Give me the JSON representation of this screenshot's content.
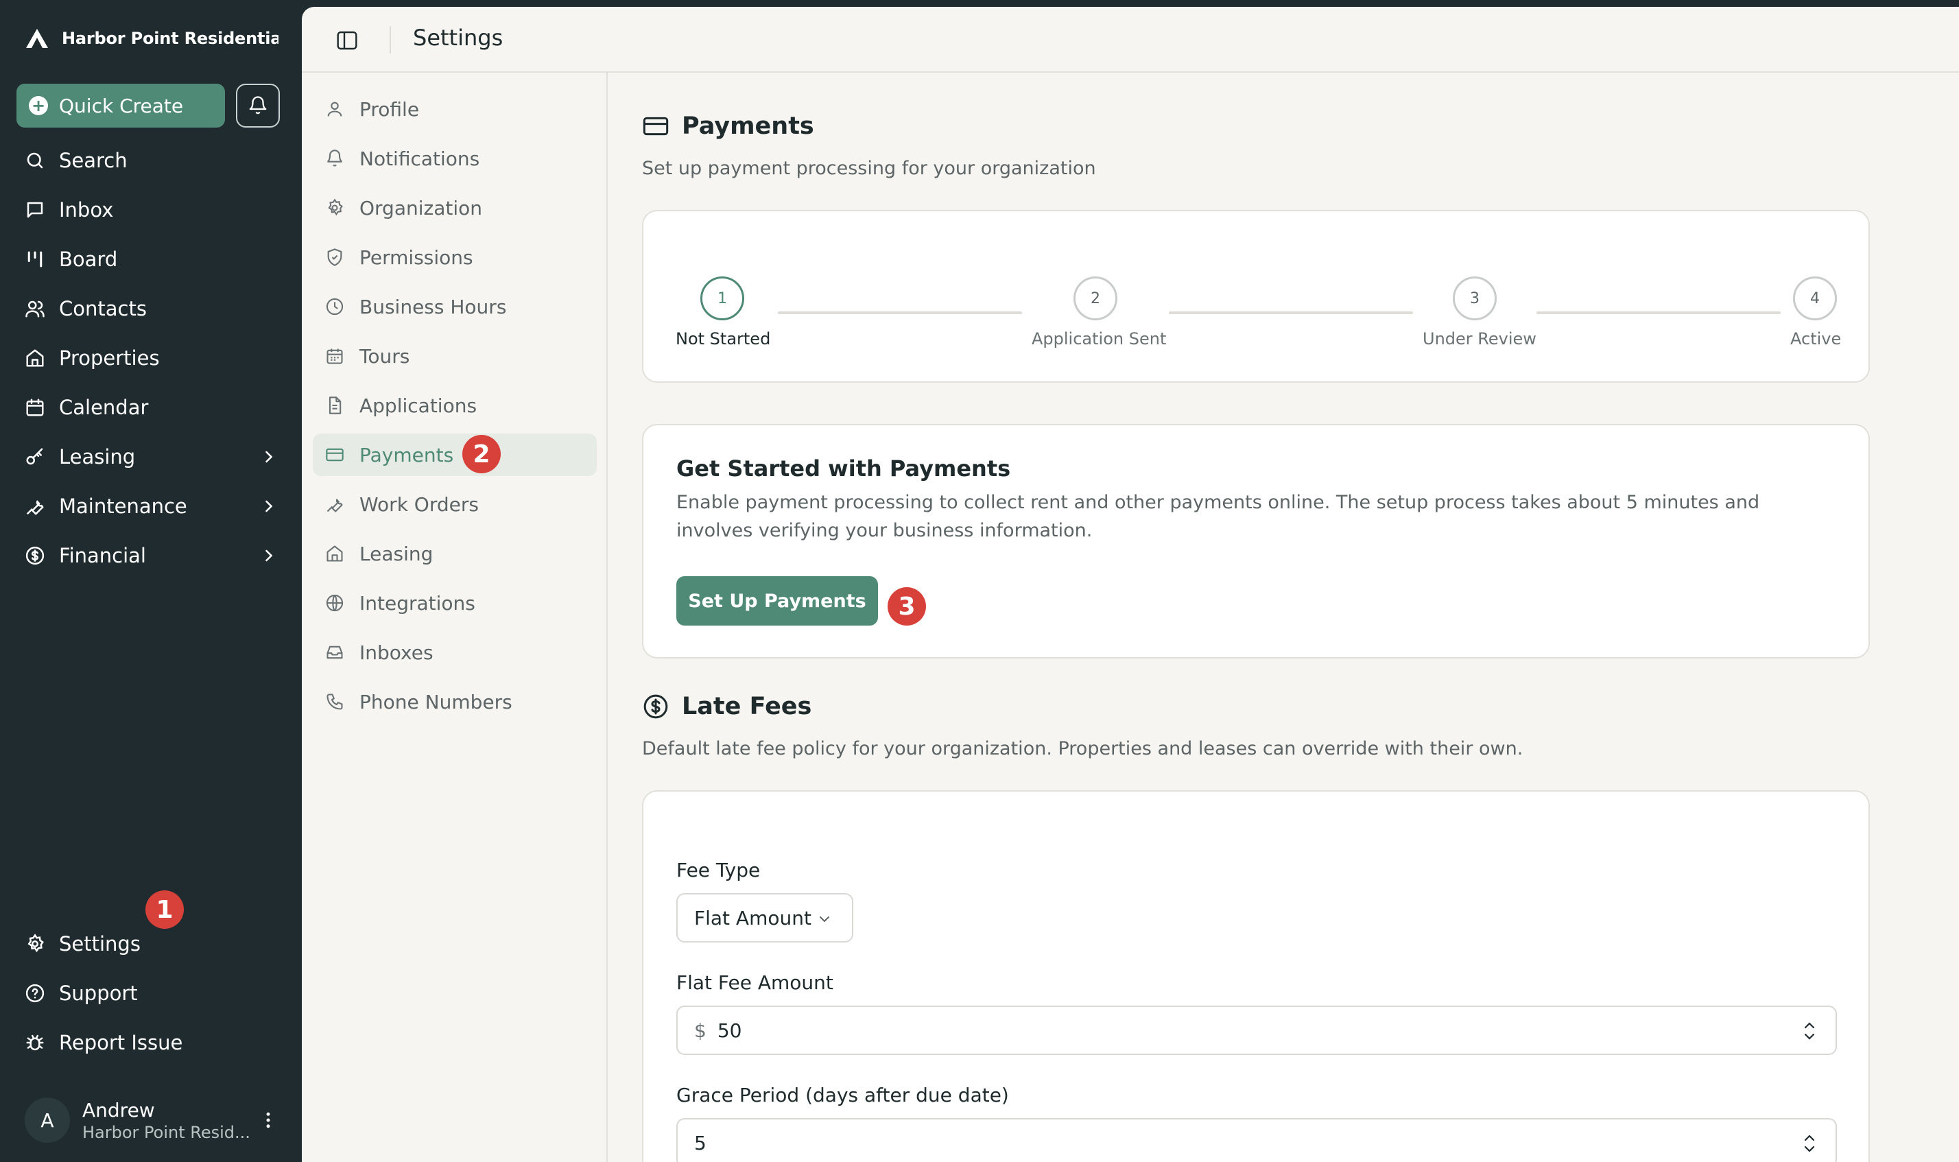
{
  "sidebar": {
    "brand": "Harbor Point Residential Pc",
    "quick_create": "Quick Create",
    "items": [
      {
        "label": "Search",
        "icon": "search-icon"
      },
      {
        "label": "Inbox",
        "icon": "inbox-icon"
      },
      {
        "label": "Board",
        "icon": "board-icon"
      },
      {
        "label": "Contacts",
        "icon": "contacts-icon"
      },
      {
        "label": "Properties",
        "icon": "home-icon"
      },
      {
        "label": "Calendar",
        "icon": "calendar-icon"
      },
      {
        "label": "Leasing",
        "icon": "key-icon"
      },
      {
        "label": "Maintenance",
        "icon": "wrench-icon"
      },
      {
        "label": "Financial",
        "icon": "dollar-circle-icon"
      }
    ],
    "bottom_items": [
      {
        "label": "Settings",
        "icon": "gear-icon"
      },
      {
        "label": "Support",
        "icon": "help-circle-icon"
      },
      {
        "label": "Report Issue",
        "icon": "bug-icon"
      }
    ],
    "user": {
      "initial": "A",
      "name": "Andrew",
      "org": "Harbor Point Resid..."
    }
  },
  "markers": {
    "m1": "1",
    "m2": "2",
    "m3": "3"
  },
  "topbar": {
    "title": "Settings"
  },
  "settings_nav": [
    {
      "label": "Profile"
    },
    {
      "label": "Notifications"
    },
    {
      "label": "Organization"
    },
    {
      "label": "Permissions"
    },
    {
      "label": "Business Hours"
    },
    {
      "label": "Tours"
    },
    {
      "label": "Applications"
    },
    {
      "label": "Payments"
    },
    {
      "label": "Work Orders"
    },
    {
      "label": "Leasing"
    },
    {
      "label": "Integrations"
    },
    {
      "label": "Inboxes"
    },
    {
      "label": "Phone Numbers"
    }
  ],
  "payments": {
    "title": "Payments",
    "subtitle": "Set up payment processing for your organization",
    "steps": [
      {
        "number": "1",
        "label": "Not Started"
      },
      {
        "number": "2",
        "label": "Application Sent"
      },
      {
        "number": "3",
        "label": "Under Review"
      },
      {
        "number": "4",
        "label": "Active"
      }
    ],
    "get_started": {
      "title": "Get Started with Payments",
      "description": "Enable payment processing to collect rent and other payments online. The setup process takes about 5 minutes and involves verifying your business information.",
      "button": "Set Up Payments"
    }
  },
  "late_fees": {
    "title": "Late Fees",
    "subtitle": "Default late fee policy for your organization. Properties and leases can override with their own.",
    "fee_type_label": "Fee Type",
    "fee_type_value": "Flat Amount",
    "flat_fee_label": "Flat Fee Amount",
    "currency": "$",
    "flat_fee_value": "50",
    "grace_label": "Grace Period (days after due date)",
    "grace_value": "5"
  },
  "colors": {
    "accent": "#4e8a76",
    "sidebar_bg": "#1f2b2e",
    "marker": "#d8403a"
  }
}
